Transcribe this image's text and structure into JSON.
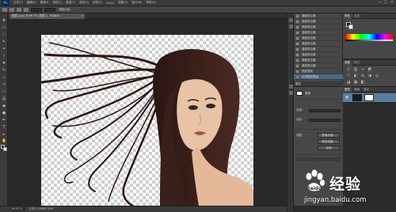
{
  "app": {
    "logo": "Ps"
  },
  "menu": [
    "文件(F)",
    "编辑(E)",
    "图像(I)",
    "图层(L)",
    "类型(Y)",
    "选择(S)",
    "滤镜(T)",
    "3D(D)",
    "视图(V)",
    "窗口(W)",
    "帮助(H)"
  ],
  "window_controls": [
    "—",
    "□",
    "✕"
  ],
  "document": {
    "tab_title": "图层1.jpg @ 66.7% (图层 1, RGB/8)",
    "zoom": "66.67%",
    "doc_info": "文档:2.40M/8.31M"
  },
  "options_bar": {
    "labels": [
      "调整边缘..."
    ]
  },
  "history": {
    "items": [
      "通道混合器",
      "通道混合器",
      "通道混合器",
      "通道混合器",
      "通道混合器",
      "通道混合器",
      "通道混合器",
      "通道混合器",
      "通道混合器",
      "通道混合器",
      "图层蒙版",
      "应用图层蒙版"
    ],
    "active_index": 11
  },
  "color_panel": {
    "tabs": [
      "颜色",
      "色板"
    ]
  },
  "adjustments_panel": {
    "tabs": [
      "调整",
      "样式"
    ]
  },
  "layers_panel": {
    "tabs": [
      "图层",
      "通道",
      "路径"
    ]
  },
  "properties": {
    "title": "属性",
    "subtitle": "蒙版",
    "rows": [
      "浓度:",
      "羽化:"
    ],
    "section": "调整:",
    "buttons": [
      "蒙版边缘...",
      "颜色范围...",
      "反相"
    ]
  },
  "watermark": {
    "brand": "Baidu",
    "main": "经验",
    "url": "jingyan.baidu.com"
  },
  "colors": {
    "accent_selected": "#4b6987",
    "layer_selected": "#5a7da0",
    "hair": "#3a1f1a",
    "skin": "#e8c3a6"
  }
}
